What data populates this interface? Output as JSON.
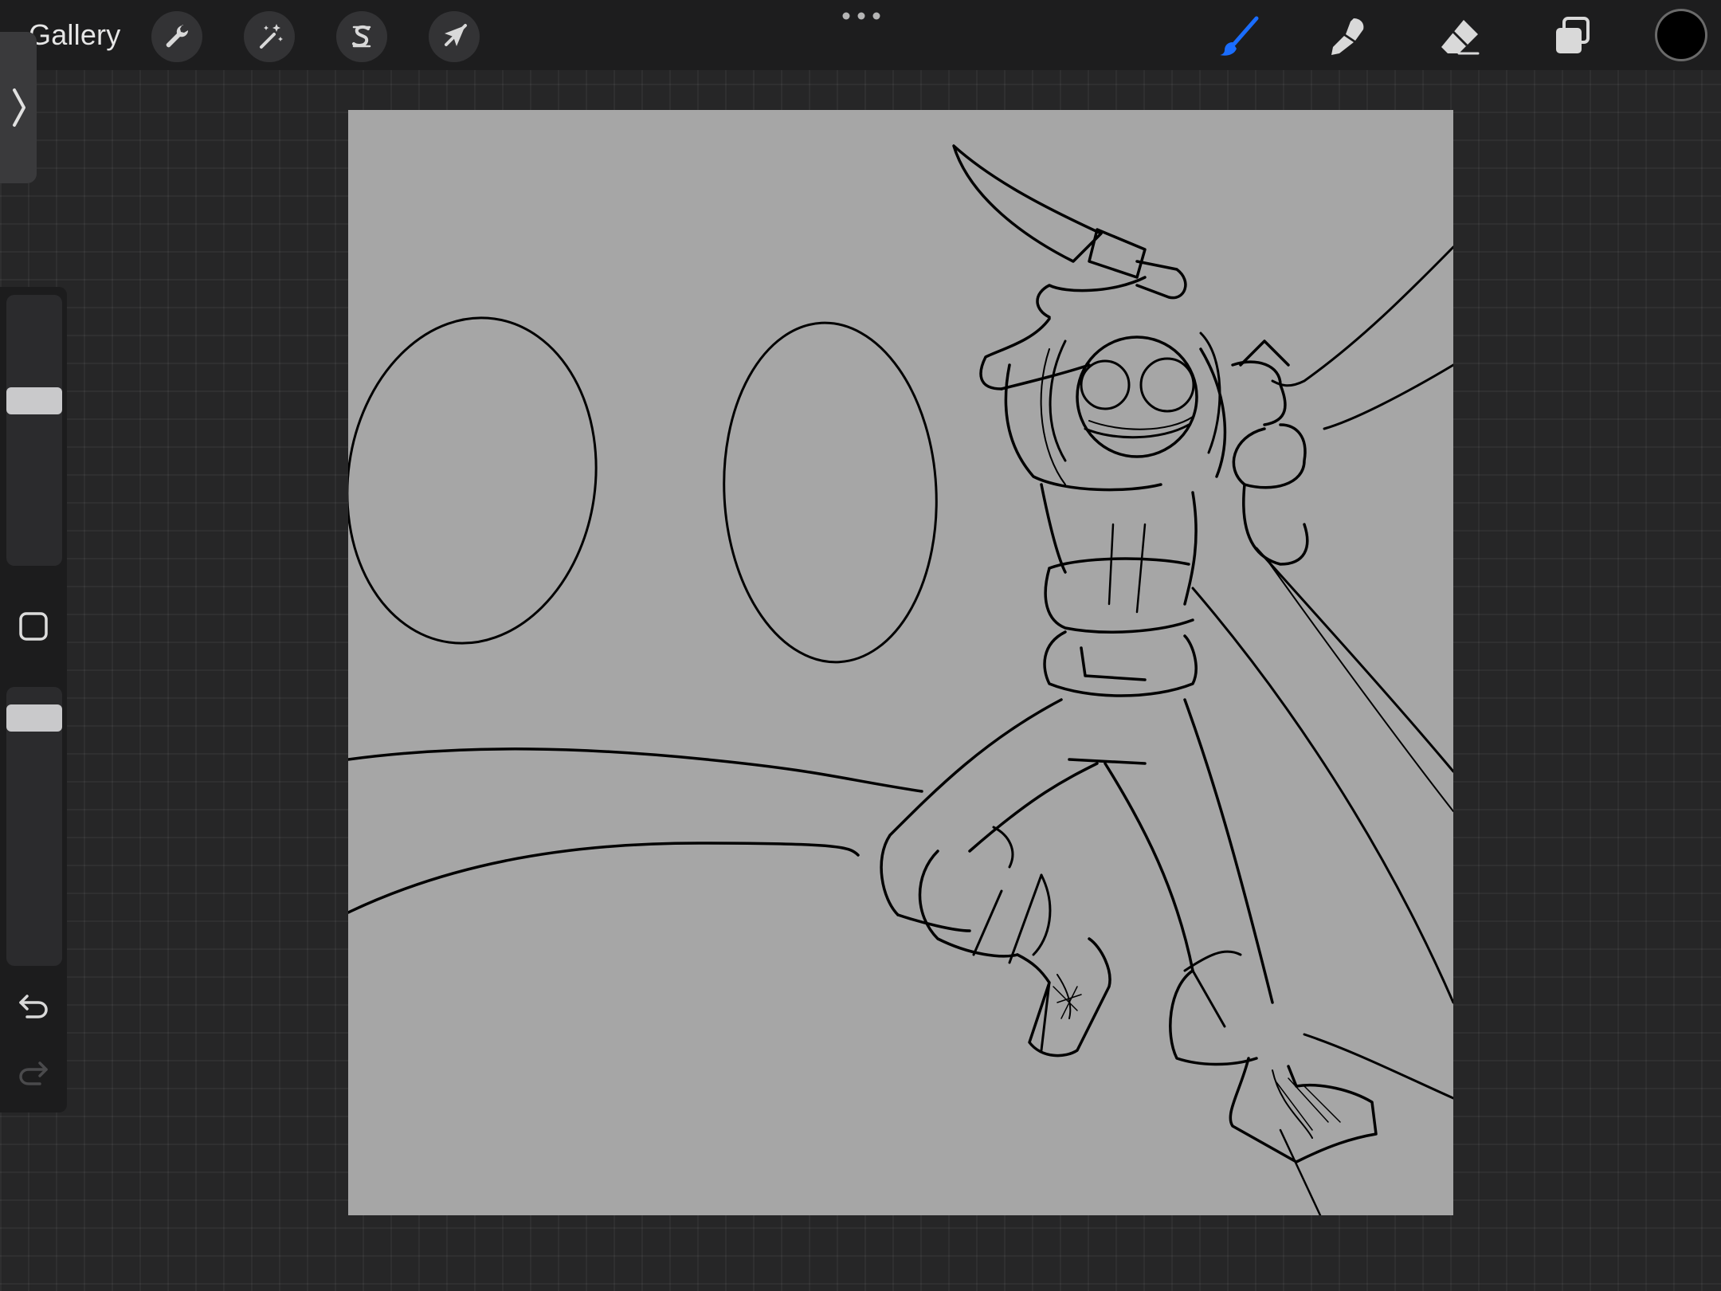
{
  "topbar": {
    "gallery_label": "Gallery",
    "left_tools": [
      {
        "name": "actions",
        "icon": "wrench-icon"
      },
      {
        "name": "adjustments",
        "icon": "magic-wand-icon"
      },
      {
        "name": "selection",
        "icon": "selection-s-icon"
      },
      {
        "name": "transform",
        "icon": "arrow-cursor-icon"
      }
    ],
    "more_icon": "more-dots-icon",
    "right_tools": [
      {
        "name": "brush",
        "icon": "brush-icon",
        "active": true
      },
      {
        "name": "smudge",
        "icon": "smudge-icon",
        "active": false
      },
      {
        "name": "eraser",
        "icon": "eraser-icon",
        "active": false
      },
      {
        "name": "layers",
        "icon": "layers-icon",
        "active": false
      }
    ],
    "current_color": "#000000",
    "active_tool_color": "#1a6dff"
  },
  "sidebar": {
    "collapse_icon": "chevron-right-icon",
    "brush_size_level": 0.72,
    "opacity_level": 0.93,
    "modify_icon": "square-modify-icon",
    "undo_icon": "undo-icon",
    "redo_icon": "redo-icon"
  },
  "canvas": {
    "background": "#a6a6a6",
    "stroke_color": "#000000"
  }
}
